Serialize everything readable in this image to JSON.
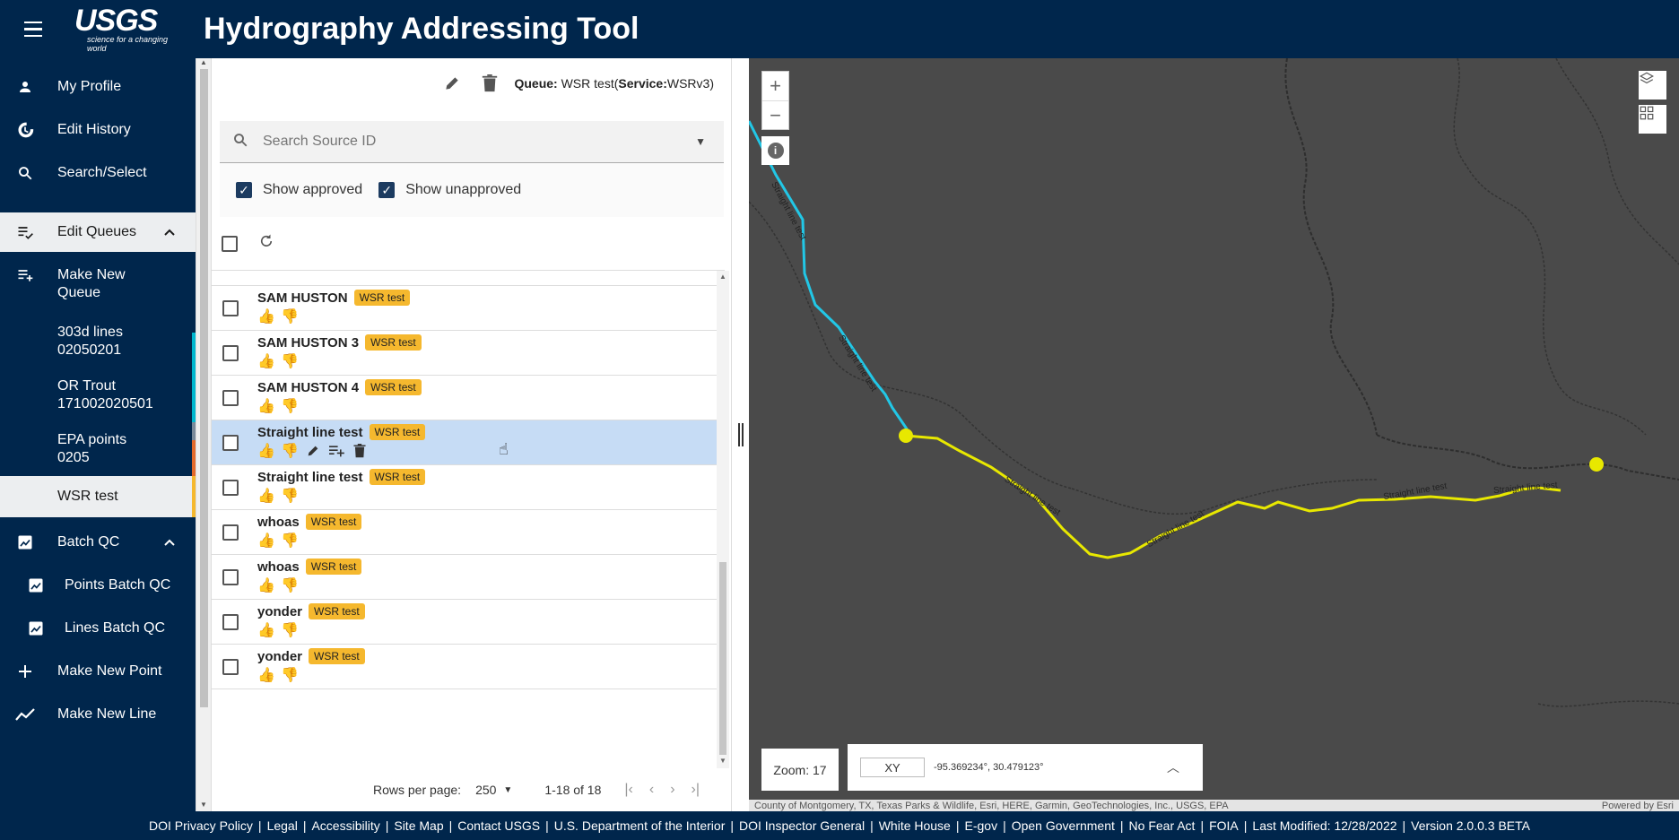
{
  "header": {
    "logo": "USGS",
    "logo_tagline": "science for a changing world",
    "title": "Hydrography Addressing Tool"
  },
  "nav": {
    "my_profile": "My Profile",
    "edit_history": "Edit History",
    "search_select": "Search/Select",
    "edit_queues": "Edit Queues",
    "make_new_queue": "Make New Queue",
    "queues": [
      {
        "label": "303d lines 02050201"
      },
      {
        "label": "OR Trout 171002020501"
      },
      {
        "label": "EPA points 0205"
      },
      {
        "label": "WSR test"
      }
    ],
    "batch_qc": "Batch QC",
    "points_batch_qc": "Points Batch QC",
    "lines_batch_qc": "Lines Batch QC",
    "make_new_point": "Make New Point",
    "make_new_line": "Make New Line",
    "colors": {
      "bar_1": "#00b7cf",
      "bar_3": "#e26a2c",
      "bar_4": "#f5b82e"
    }
  },
  "list": {
    "queue_label_prefix": "Queue:",
    "queue_name": "WSR test",
    "service_open": "(",
    "service_label": "Service:",
    "service_name": "WSRv3",
    "service_close": ")",
    "search_placeholder": "Search Source ID",
    "show_approved": "Show approved",
    "show_unapproved": "Show unapproved",
    "rows": [
      {
        "name": "SAM HUSTON",
        "tag": "WSR test",
        "up": "gray",
        "down": "blue"
      },
      {
        "name": "SAM HUSTON 3",
        "tag": "WSR test",
        "up": "gray",
        "down": "blue"
      },
      {
        "name": "SAM HUSTON 4",
        "tag": "WSR test",
        "up": "gray",
        "down": "blue"
      },
      {
        "name": "Straight line test",
        "tag": "WSR test",
        "up": "gray",
        "down": "blue"
      },
      {
        "name": "Straight line test",
        "tag": "WSR test",
        "up": "blue",
        "down": "gray"
      },
      {
        "name": "whoas",
        "tag": "WSR test",
        "up": "blue",
        "down": "gray"
      },
      {
        "name": "whoas",
        "tag": "WSR test",
        "up": "blue",
        "down": "gray"
      },
      {
        "name": "yonder",
        "tag": "WSR test",
        "up": "blue",
        "down": "gray"
      },
      {
        "name": "yonder",
        "tag": "WSR test",
        "up": "blue",
        "down": "gray"
      }
    ],
    "rows_per_page_label": "Rows per page:",
    "rows_per_page_value": "250",
    "range": "1-18 of 18"
  },
  "map": {
    "zoom_label": "Zoom: 17",
    "coord_mode": "XY",
    "coords": "-95.369234°, 30.479123°",
    "attribution": "County of Montgomery, TX, Texas Parks & Wildlife, Esri, HERE, Garmin, GeoTechnologies, Inc., USGS, EPA",
    "powered_by": "Powered by Esri",
    "line_label_1": "Straight line test",
    "line_label_2": "Straight line test",
    "line_label_3": "Straight line test",
    "line_label_4": "Straight line test",
    "line_label_5": "Straight line test",
    "line_label_6": "Straight line test",
    "colors": {
      "background": "#4a4a4a",
      "cyan_line": "#22c7e6",
      "yellow_line": "#e8e800"
    }
  },
  "footer": {
    "links": [
      "DOI Privacy Policy",
      "Legal",
      "Accessibility",
      "Site Map",
      "Contact USGS",
      "U.S. Department of the Interior",
      "DOI Inspector General",
      "White House",
      "E-gov",
      "Open Government",
      "No Fear Act",
      "FOIA",
      "Last Modified: 12/28/2022",
      "Version 2.0.0.3 BETA"
    ]
  }
}
